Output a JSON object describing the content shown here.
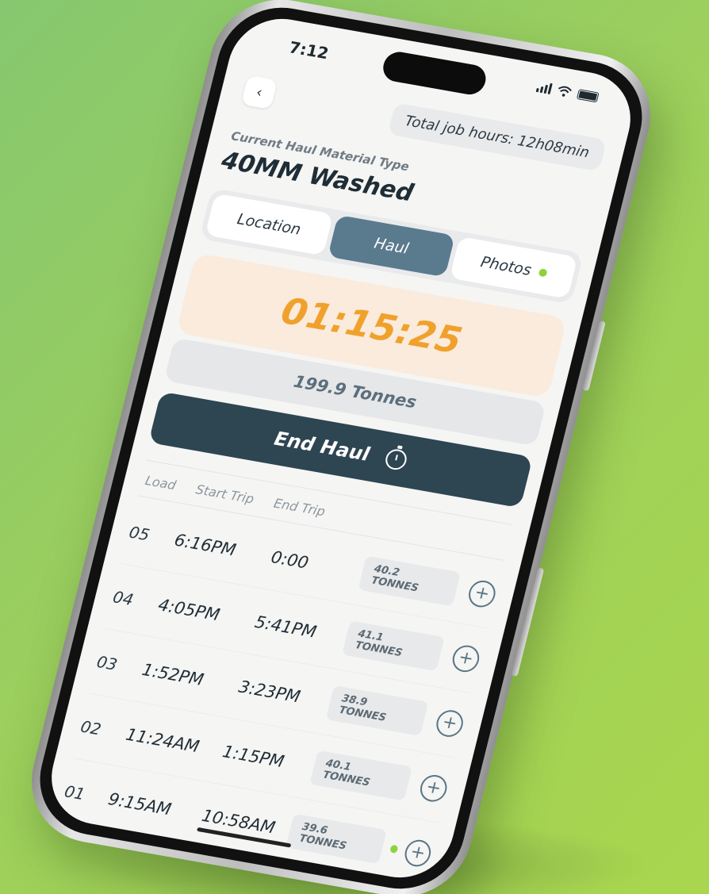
{
  "status_bar": {
    "time": "7:12"
  },
  "header": {
    "back_icon": "chevron-left-icon",
    "total_hours": "Total job hours: 12h08min",
    "subtitle": "Current Haul Material Type",
    "title": "40MM Washed"
  },
  "tabs": [
    {
      "label": "Location",
      "active": false
    },
    {
      "label": "Haul",
      "active": true
    },
    {
      "label": "Photos",
      "active": false,
      "has_indicator": true
    }
  ],
  "timer": "01:15:25",
  "tonnes_total": "199.9 Tonnes",
  "end_button": {
    "label": "End Haul",
    "icon": "stopwatch-icon"
  },
  "table": {
    "headers": [
      "Load",
      "Start Trip",
      "End Trip"
    ],
    "rows": [
      {
        "load": "05",
        "start": "6:16PM",
        "end": "0:00",
        "tonnes": "40.2 TONNES",
        "indicator": false
      },
      {
        "load": "04",
        "start": "4:05PM",
        "end": "5:41PM",
        "tonnes": "41.1 TONNES",
        "indicator": false
      },
      {
        "load": "03",
        "start": "1:52PM",
        "end": "3:23PM",
        "tonnes": "38.9 TONNES",
        "indicator": false
      },
      {
        "load": "02",
        "start": "11:24AM",
        "end": "1:15PM",
        "tonnes": "40.1 TONNES",
        "indicator": false
      },
      {
        "load": "01",
        "start": "9:15AM",
        "end": "10:58AM",
        "tonnes": "39.6 TONNES",
        "indicator": true
      }
    ]
  },
  "colors": {
    "background": "#9ccf5d",
    "accent_timer": "#f0a12c",
    "active_tab": "#5a7a8e",
    "end_button": "#2e4552",
    "indicator": "#8cd33d"
  }
}
